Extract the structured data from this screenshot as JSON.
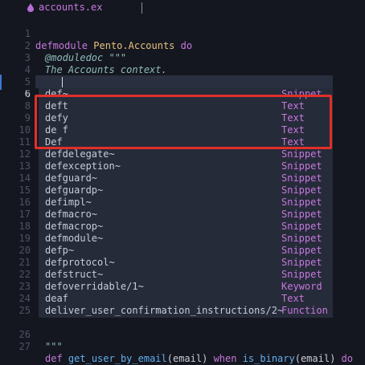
{
  "tab": {
    "filename": "accounts.ex",
    "icon": "elixir-drop-icon"
  },
  "colors": {
    "highlight_border": "#e1302a",
    "kind": "#c678dd",
    "keyword": "#c678dd"
  },
  "lines": {
    "l1": {
      "num": "1",
      "kw": "defmodule",
      "mod": "Pento.Accounts",
      "kw2": "do"
    },
    "l2": {
      "num": "2",
      "text": "@moduledoc \"\"\""
    },
    "l3": {
      "num": "3",
      "text": "The Accounts context."
    },
    "l4": {
      "num": "4",
      "text": "\"\"\""
    },
    "l5": {
      "num": "5"
    },
    "l6": {
      "num": "6",
      "text": "def"
    },
    "l26": {
      "num": "26",
      "text": "\"\"\""
    },
    "l27": {
      "num": "27",
      "kw": "def",
      "fn": "get_user_by_email",
      "args": "(email)",
      "kw2": "when",
      "fn2": "is_binary",
      "args2": "(email)",
      "kw3": "do"
    }
  },
  "gutter_numbers": [
    "7",
    "8",
    "9",
    "10",
    "11",
    "12",
    "13",
    "14",
    "15",
    "16",
    "17",
    "18",
    "19",
    "20",
    "21",
    "22",
    "23",
    "24",
    "25"
  ],
  "completions": [
    {
      "label": "def~",
      "kind": "Snippet"
    },
    {
      "label": "deft",
      "kind": "Text"
    },
    {
      "label": "defy",
      "kind": "Text"
    },
    {
      "label": "de f",
      "kind": "Text"
    },
    {
      "label": "Def",
      "kind": "Text"
    },
    {
      "label": "defdelegate~",
      "kind": "Snippet"
    },
    {
      "label": "defexception~",
      "kind": "Snippet"
    },
    {
      "label": "defguard~",
      "kind": "Snippet"
    },
    {
      "label": "defguardp~",
      "kind": "Snippet"
    },
    {
      "label": "defimpl~",
      "kind": "Snippet"
    },
    {
      "label": "defmacro~",
      "kind": "Snippet"
    },
    {
      "label": "defmacrop~",
      "kind": "Snippet"
    },
    {
      "label": "defmodule~",
      "kind": "Snippet"
    },
    {
      "label": "defp~",
      "kind": "Snippet"
    },
    {
      "label": "defprotocol~",
      "kind": "Snippet"
    },
    {
      "label": "defstruct~",
      "kind": "Snippet"
    },
    {
      "label": "defoverridable/1~",
      "kind": "Keyword"
    },
    {
      "label": "deaf",
      "kind": "Text"
    },
    {
      "label": "deliver_user_confirmation_instructions/2~",
      "kind": "Function"
    }
  ]
}
